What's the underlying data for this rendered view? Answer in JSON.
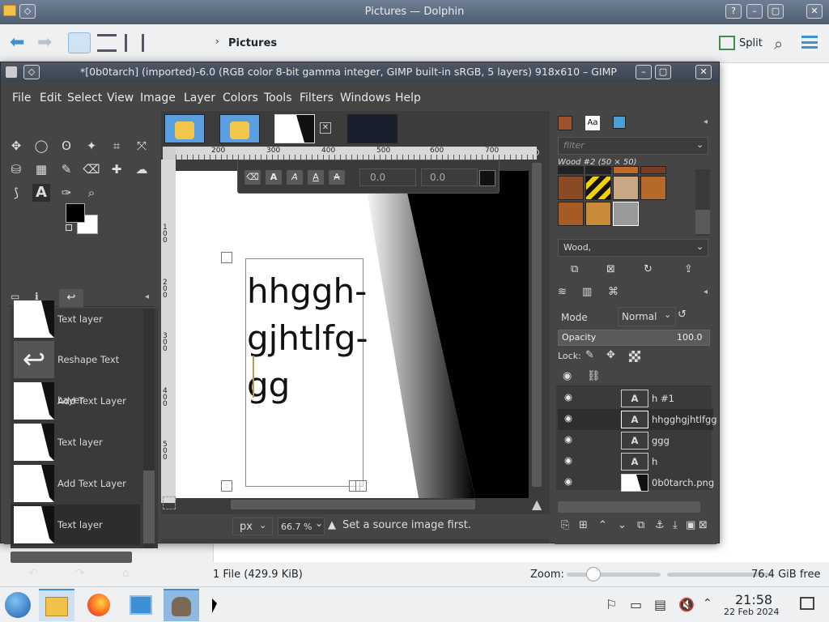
{
  "dolphin": {
    "title": "Pictures — Dolphin",
    "breadcrumb": "Pictures",
    "split_label": "Split",
    "status_files": "1 File (429.9 KiB)",
    "zoom_label": "Zoom:",
    "zoom_fraction": 0.18,
    "free_space": "76.4 GiB free"
  },
  "gimp": {
    "title": "*[0b0tarch] (imported)-6.0 (RGB color 8-bit gamma integer, GIMP built-in sRGB, 5 layers) 918x610 – GIMP",
    "menu": [
      "File",
      "Edit",
      "Select",
      "View",
      "Image",
      "Layer",
      "Colors",
      "Tools",
      "Filters",
      "Windows",
      "Help"
    ],
    "tools": [
      {
        "icon": "move-icon",
        "glyph": "✥"
      },
      {
        "icon": "ellipse-select-icon",
        "glyph": "◯"
      },
      {
        "icon": "free-select-icon",
        "glyph": "ʘ"
      },
      {
        "icon": "fuzzy-select-icon",
        "glyph": "✦"
      },
      {
        "icon": "crop-icon",
        "glyph": "⌗"
      },
      {
        "icon": "unified-transform-icon",
        "glyph": "⤧"
      },
      {
        "icon": "bucket-fill-icon",
        "glyph": "⛁"
      },
      {
        "icon": "gradient-icon",
        "glyph": "▦"
      },
      {
        "icon": "paintbrush-icon",
        "glyph": "✎"
      },
      {
        "icon": "eraser-icon",
        "glyph": "⌫"
      },
      {
        "icon": "heal-icon",
        "glyph": "✚"
      },
      {
        "icon": "smudge-icon",
        "glyph": "☁"
      },
      {
        "icon": "paths-icon",
        "glyph": "⟆"
      },
      {
        "icon": "text-tool-icon",
        "glyph": "A"
      },
      {
        "icon": "color-picker-icon",
        "glyph": "✑"
      },
      {
        "icon": "zoom-tool-icon",
        "glyph": "⌕"
      }
    ],
    "history": [
      "Text layer",
      "Reshape Text Layer",
      "Add Text Layer",
      "Text layer",
      "Add Text Layer",
      "Text layer"
    ],
    "canvas_text": "hhggh-\ngjhtlfg-\ngg",
    "ruler_ticks": [
      "200",
      "300",
      "400",
      "500",
      "600",
      "700"
    ],
    "vruler_ticks": [
      "100",
      "200",
      "300",
      "400",
      "500"
    ],
    "text_toolbar": {
      "baseline": "0.0",
      "kerning": "0.0"
    },
    "unit": "px",
    "zoom": "66.7 %",
    "status_message": "Set a source image first.",
    "patterns": {
      "filter_placeholder": "filter",
      "selected_name": "Wood #2 (50 × 50)",
      "tag": "Wood,"
    },
    "layers_panel": {
      "mode_label": "Mode",
      "mode_value": "Normal",
      "opacity_label": "Opacity",
      "opacity_value": "100.0",
      "lock_label": "Lock:",
      "layers": [
        "h #1",
        "hhgghgjhtlfgg",
        "ggg",
        "h",
        "0b0tarch.png"
      ]
    }
  },
  "taskbar": {
    "time": "21:58",
    "date": "22 Feb 2024"
  }
}
